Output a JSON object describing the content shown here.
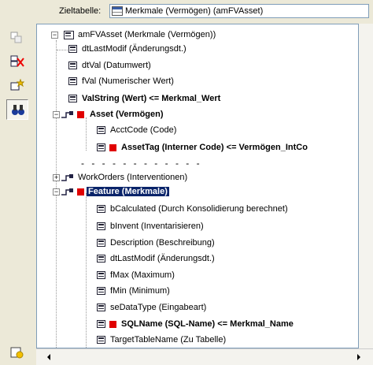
{
  "header": {
    "label": "Zieltabelle:",
    "combo_value": "Merkmale (Vermögen) (amFVAsset)"
  },
  "toolbar": [
    "copy-tool-icon",
    "delete-link-icon",
    "new-star-icon",
    "binoculars-icon",
    "settings-icon"
  ],
  "tree": {
    "root": "amFVAsset (Merkmale (Vermögen))",
    "rows": [
      {
        "text": "dtLastModif (Änderungsdt.)"
      },
      {
        "text": "dtVal (Datumwert)"
      },
      {
        "text": "fVal (Numerischer Wert)"
      },
      {
        "text": "ValString (Wert)  <=  Merkmal_Wert"
      },
      {
        "text": "Asset (Vermögen)"
      },
      {
        "text": "AcctCode (Code)"
      },
      {
        "text": "AssetTag (Interner Code)  <=  Vermögen_IntCo"
      },
      {
        "text": "WorkOrders (Interventionen)"
      },
      {
        "text": "Feature (Merkmale)"
      },
      {
        "text": "bCalculated (Durch Konsolidierung berechnet)"
      },
      {
        "text": "bInvent (Inventarisieren)"
      },
      {
        "text": "Description (Beschreibung)"
      },
      {
        "text": "dtLastModif (Änderungsdt.)"
      },
      {
        "text": "fMax (Maximum)"
      },
      {
        "text": "fMin (Minimum)"
      },
      {
        "text": "seDataType (Eingabeart)"
      },
      {
        "text": "SQLName (SQL-Name)  <=  Merkmal_Name"
      },
      {
        "text": "TargetTableName (Zu Tabelle)"
      }
    ],
    "separator": "- - - - - - - - - - - -"
  }
}
